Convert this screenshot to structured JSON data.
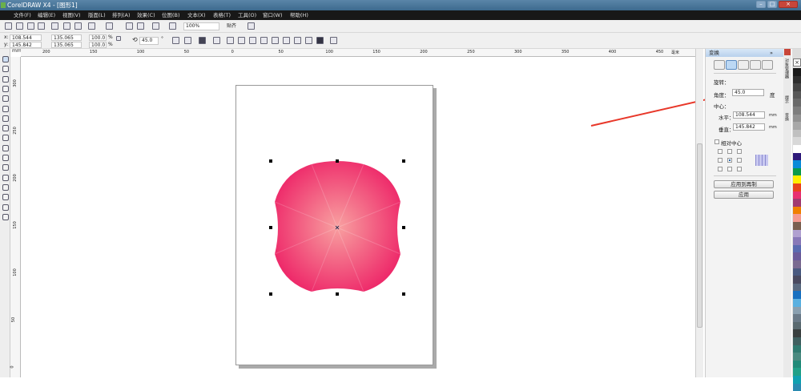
{
  "window": {
    "title": "CorelDRAW X4 - [图形1]"
  },
  "menu": [
    "文件(F)",
    "编辑(E)",
    "视图(V)",
    "版面(L)",
    "排列(A)",
    "效果(C)",
    "位图(B)",
    "文本(X)",
    "表格(T)",
    "工具(O)",
    "窗口(W)",
    "帮助(H)"
  ],
  "toolbar": {
    "zoom": "100%",
    "snap": "贴齐"
  },
  "property_bar": {
    "x": "108.544 mm",
    "y": "145.842 mm",
    "width": "135.065 mm",
    "height": "135.065 mm",
    "scale_x": "100.0",
    "scale_y": "100.0",
    "pct": "%",
    "angle": "45.0",
    "deg": "°",
    "x_label": "x:",
    "y_label": "y:"
  },
  "ruler_top": [
    "200",
    "150",
    "100",
    "50",
    "0",
    "50",
    "100",
    "150",
    "200",
    "250",
    "300",
    "350",
    "400",
    "450"
  ],
  "ruler_unit": "毫米",
  "ruler_left": [
    "300",
    "250",
    "200",
    "150",
    "100",
    "50",
    "0"
  ],
  "docker": {
    "title": "变换",
    "rotate_label": "旋转：",
    "angle_label": "角度：",
    "angle_value": "45.0",
    "angle_unit": "度",
    "center_label": "中心：",
    "h_label": "水平：",
    "h_value": "108.544",
    "h_unit": "mm",
    "v_label": "垂直：",
    "v_value": "145.842",
    "v_unit": "mm",
    "relative_center": "相对中心",
    "apply_copy": "应用到再制",
    "apply": "应用",
    "side_tabs": [
      "对象管理器",
      "提示",
      "变换"
    ]
  },
  "shape": {
    "fill_center": "#f8a0a0",
    "fill_edge": "#ee2a6a"
  },
  "annotation_color": "#e8382a",
  "palette": [
    "#1a1a1a",
    "#2e2e2e",
    "#444444",
    "#585858",
    "#6a6a6a",
    "#7e7e7e",
    "#929292",
    "#a8a8a8",
    "#c0c0c0",
    "#d8d8d8",
    "#ffffff",
    "#2e1a7a",
    "#0a8ad8",
    "#0a9a4a",
    "#ffee00",
    "#e8431c",
    "#e83070",
    "#a03a70",
    "#f08000",
    "#f49a90",
    "#7a6050",
    "#b0a0d0",
    "#8878b8",
    "#5a6ab0",
    "#6a5a9a",
    "#7a6a90",
    "#4a5a80",
    "#4a4a60",
    "#5a6a80",
    "#1870c0",
    "#5ab0e0",
    "#8aa0b0",
    "#6a7a88",
    "#5a6a70",
    "#3a4040",
    "#406060",
    "#307a70",
    "#4a8a80",
    "#208a78",
    "#20a088",
    "#10a0b0",
    "#2a8ab0"
  ]
}
